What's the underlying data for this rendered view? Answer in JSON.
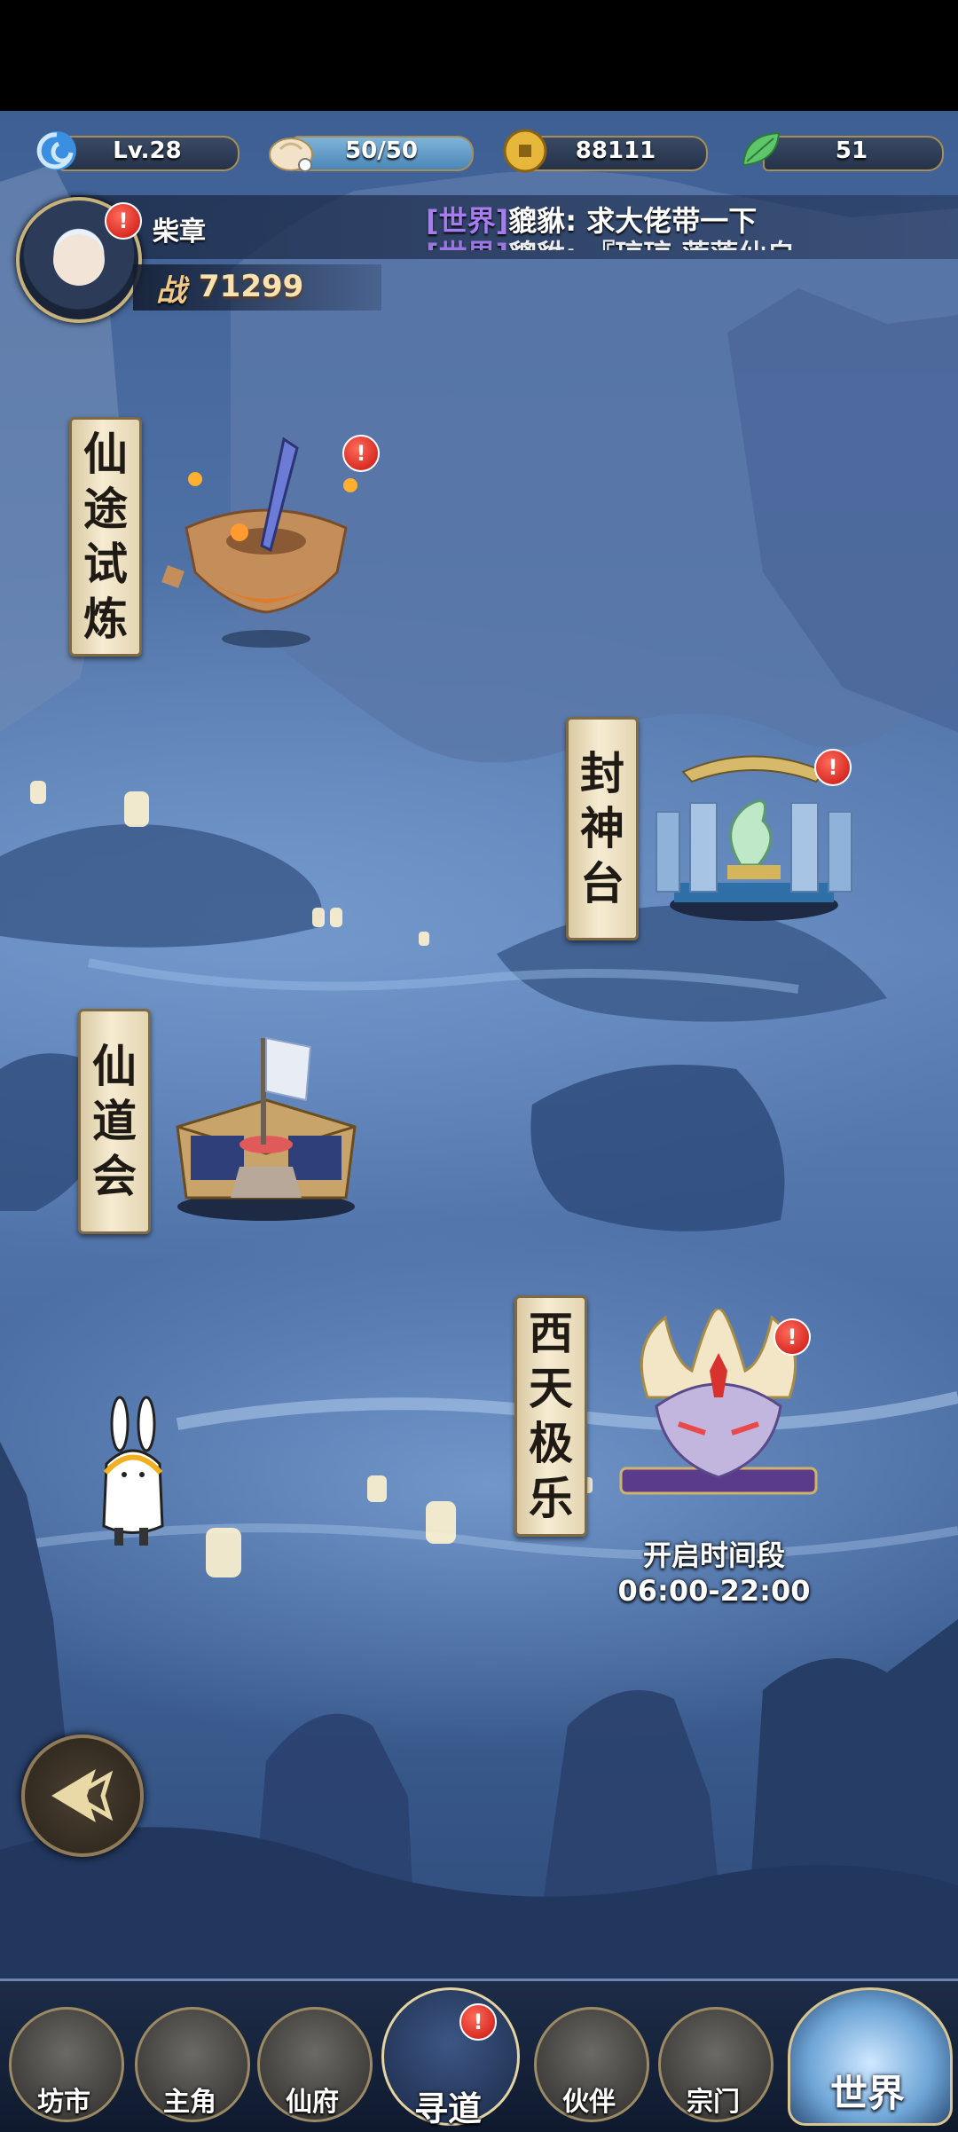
{
  "resources": [
    {
      "icon": "level-swirl-icon",
      "value": "Lv.28"
    },
    {
      "icon": "bun-stamina-icon",
      "value": "50/50"
    },
    {
      "icon": "copper-coin-icon",
      "value": "88111"
    },
    {
      "icon": "jade-leaf-icon",
      "value": "51"
    }
  ],
  "player": {
    "name": "柴章",
    "power_label": "战",
    "power_value": "71299"
  },
  "chat": {
    "line1_tag": "[世界]",
    "line1_text": "貔貅: 求大佬带一下",
    "line2_tag": "[世界]",
    "line2_text": "貔貅: 『琼琼 莲莲仙自"
  },
  "locations": {
    "trial": {
      "title": [
        "仙",
        "途",
        "试",
        "炼"
      ]
    },
    "fengshen": {
      "title": [
        "封",
        "神",
        "台"
      ]
    },
    "daohui": {
      "title": [
        "仙",
        "道",
        "会"
      ]
    },
    "xitian": {
      "title": [
        "西",
        "天",
        "极",
        "乐"
      ],
      "time_label": "开启时间段",
      "time_range": "06:00-22:00"
    }
  },
  "alert_symbol": "!",
  "nav": {
    "items": [
      {
        "label": "坊市"
      },
      {
        "label": "主角"
      },
      {
        "label": "仙府"
      },
      {
        "label": "寻道"
      },
      {
        "label": "伙伴"
      },
      {
        "label": "宗门"
      }
    ],
    "world_label": "世界"
  },
  "colors": {
    "chat_tag": "#a67cf0",
    "alert": "#d01a12",
    "power": "#f1c987",
    "scroll": "#f6ecd2"
  }
}
